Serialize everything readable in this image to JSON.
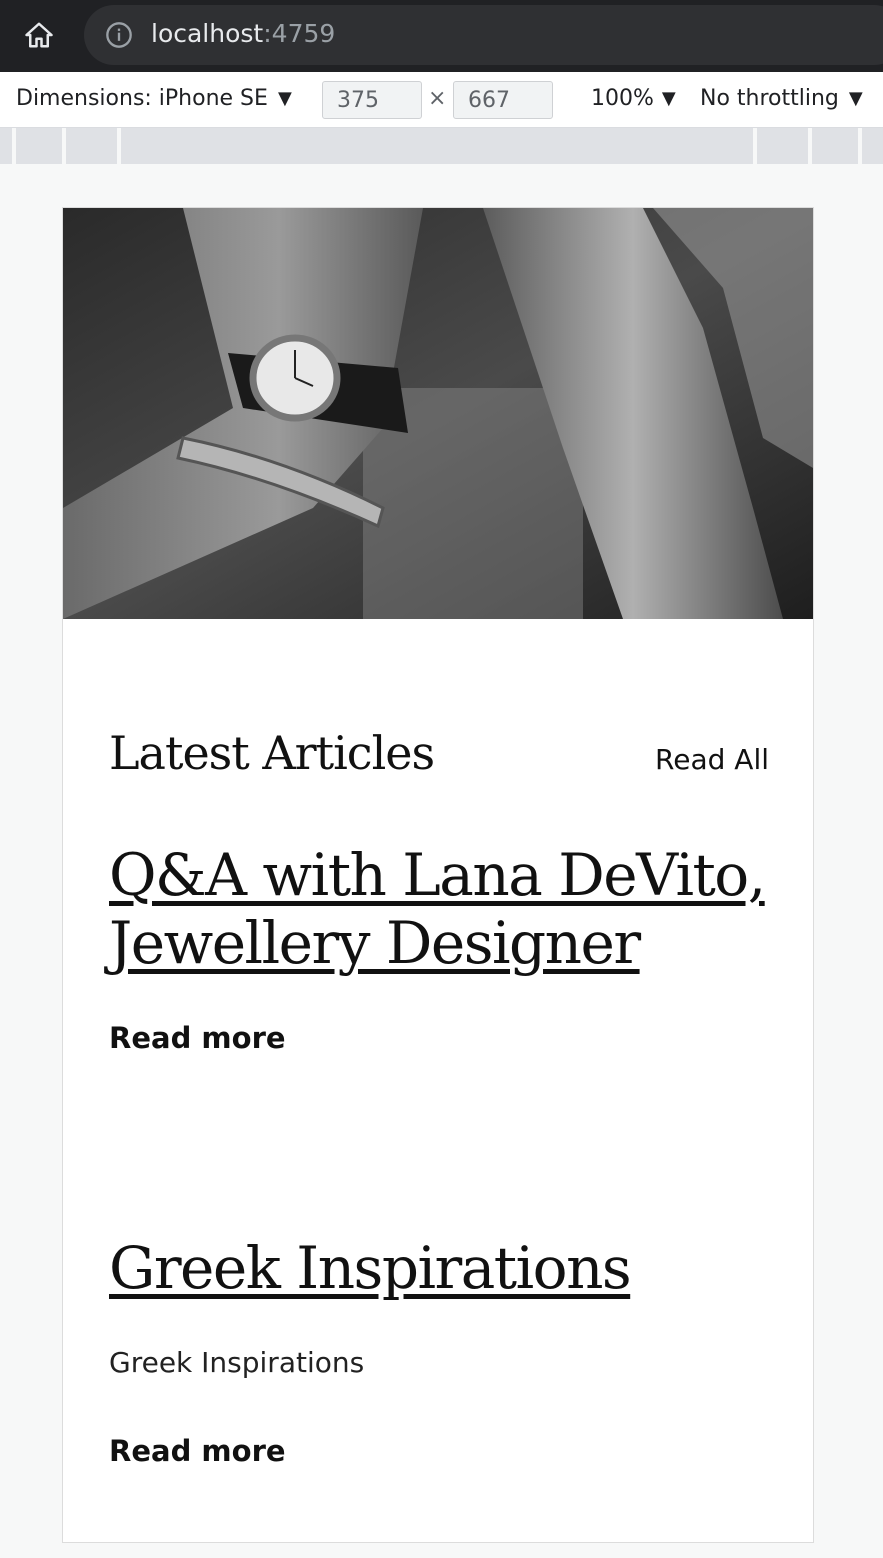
{
  "browser": {
    "url_host": "localhost",
    "url_port": ":4759"
  },
  "devtools": {
    "dimensions_label": "Dimensions: iPhone SE",
    "width": "375",
    "height": "667",
    "times": "×",
    "zoom": "100%",
    "throttling": "No throttling"
  },
  "page": {
    "hero_image": "black-and-white photo of a wrist with a watch and bangle",
    "section_title": "Latest Articles",
    "read_all": "Read All",
    "articles": [
      {
        "title": "Q&A with Lana DeVito, Jewellery Designer",
        "excerpt": "",
        "read_more": "Read more"
      },
      {
        "title": "Greek Inspirations",
        "excerpt": "Greek Inspirations",
        "read_more": "Read more"
      }
    ]
  }
}
